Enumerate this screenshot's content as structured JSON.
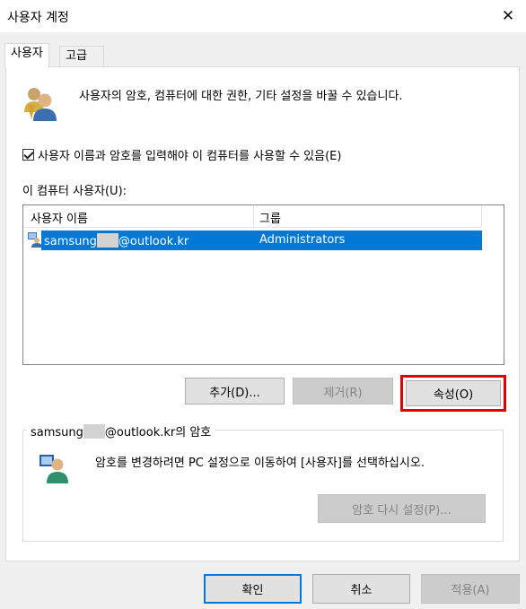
{
  "window": {
    "title": "사용자 계정"
  },
  "tabs": [
    {
      "label": "사용자"
    },
    {
      "label": "고급"
    }
  ],
  "description": "사용자의 암호, 컴퓨터에 대한 권한, 기타 설정을 바꿀 수 있습니다.",
  "require_login_checkbox": {
    "label": "사용자 이름과 암호를 입력해야 이 컴퓨터를 사용할 수 있음(E)",
    "checked": true
  },
  "users_list": {
    "label": "이 컴퓨터 사용자(U):",
    "columns": [
      "사용자 이름",
      "그룹"
    ],
    "rows": [
      {
        "user_prefix": "samsung",
        "user_suffix": "@outlook.kr",
        "group": "Administrators",
        "selected": true
      }
    ]
  },
  "list_buttons": {
    "add": "추가(D)...",
    "remove": "제거(R)",
    "properties": "속성(O)"
  },
  "password_group": {
    "title_prefix": "samsung",
    "title_suffix": "@outlook.kr의 암호",
    "message": "암호를 변경하려면 PC 설정으로 이동하여 [사용자]를 선택하십시오.",
    "reset_button": "암호 다시 설정(P)..."
  },
  "dialog_buttons": {
    "ok": "확인",
    "cancel": "취소",
    "apply": "적용(A)"
  },
  "colors": {
    "selection": "#0078d7",
    "highlight_box": "#e00000"
  },
  "icons": [
    "users-icon",
    "user-row-icon",
    "password-user-icon",
    "close-icon"
  ]
}
